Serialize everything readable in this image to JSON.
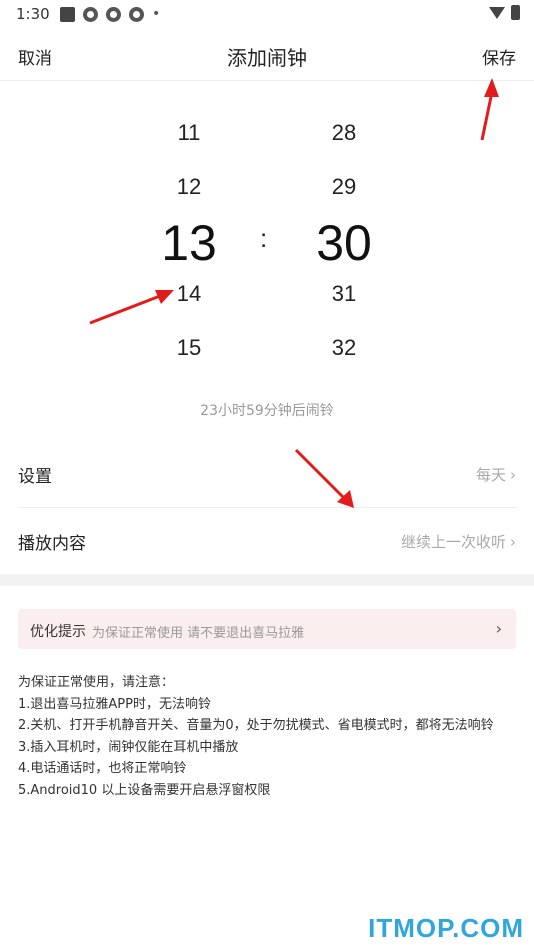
{
  "status_bar": {
    "time": "1:30"
  },
  "nav": {
    "cancel": "取消",
    "title": "添加闹钟",
    "save": "保存"
  },
  "picker": {
    "hours": [
      "11",
      "12",
      "13",
      "14",
      "15"
    ],
    "minutes": [
      "28",
      "29",
      "30",
      "31",
      "32"
    ],
    "selected_hour": "13",
    "selected_minute": "30",
    "separator": ":"
  },
  "countdown": "23小时59分钟后闹铃",
  "settings_row": {
    "label": "设置",
    "value": "每天"
  },
  "content_row": {
    "label": "播放内容",
    "value": "继续上一次收听"
  },
  "tip": {
    "title": "优化提示",
    "text": "为保证正常使用 请不要退出喜马拉雅"
  },
  "notes": [
    "为保证正常使用，请注意：",
    "1.退出喜马拉雅APP时，无法响铃",
    "2.关机、打开手机静音开关、音量为0，处于勿扰模式、省电模式时，都将无法响铃",
    "3.插入耳机时，闹钟仅能在耳机中播放",
    "4.电话通话时，也将正常响铃",
    "5.Android10 以上设备需要开启悬浮窗权限"
  ],
  "watermark": "ITMOP.COM",
  "icons": {
    "chevron": "chevron-right-icon",
    "wifi": "wifi-icon",
    "battery": "battery-icon"
  },
  "colors": {
    "watermark": "#2fa7dc",
    "tip_bg": "#fbeeee",
    "arrow": "#e21b1b"
  }
}
